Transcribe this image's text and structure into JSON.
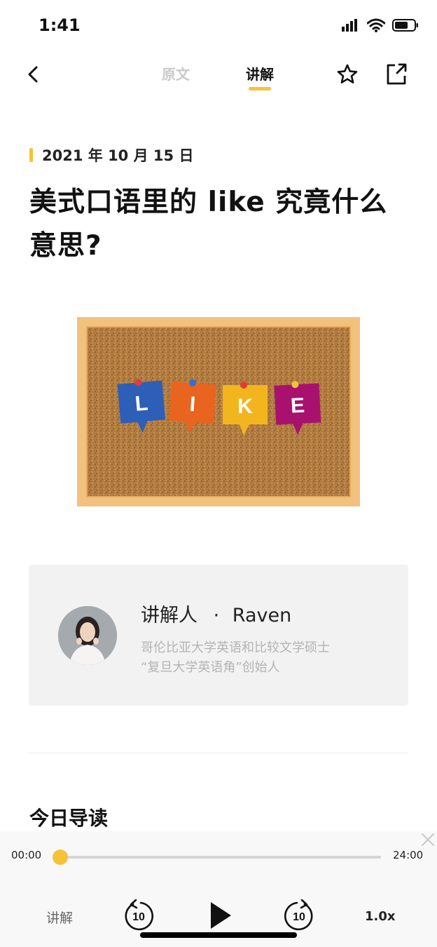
{
  "status_bar": {
    "time": "1:41",
    "icons": [
      "signal-icon",
      "wifi-icon",
      "battery-icon"
    ]
  },
  "nav": {
    "back_icon": "chevron-left-icon",
    "tabs": [
      {
        "label": "原文",
        "active": false
      },
      {
        "label": "讲解",
        "active": true
      }
    ],
    "star_icon": "star-outline-icon",
    "share_icon": "share-icon"
  },
  "article": {
    "date": "2021 年 10 月 15 日",
    "title": "美式口语里的 like 究竟什么意思?",
    "hero_image": {
      "letters": [
        "L",
        "I",
        "K",
        "E"
      ],
      "letter_colors": [
        "#2d5fb8",
        "#e9641f",
        "#f3b51e",
        "#a8126e"
      ],
      "pin_colors": [
        "#e23b3b",
        "#2f6fd8",
        "#e23b3b",
        "#f5c23a"
      ],
      "frame_color": "#f3c17e",
      "cork_color": "#b07a3e"
    }
  },
  "speaker": {
    "label": "讲解人",
    "separator": "·",
    "name": "Raven",
    "bio_line1": "哥伦比亚大学英语和比较文学硕士",
    "bio_line2": "“复旦大学英语角”创始人"
  },
  "section": {
    "heading": "今日导读"
  },
  "player": {
    "current_time": "00:00",
    "total_time": "24:00",
    "progress": 0.0,
    "mode_label": "讲解",
    "rewind_seconds": "10",
    "forward_seconds": "10",
    "speed": "1.0x",
    "close_icon": "close-icon",
    "play_icon": "play-icon"
  },
  "colors": {
    "accent": "#f5c23a",
    "card_bg": "#f2f2f2",
    "muted_text": "#b4b4b4"
  }
}
